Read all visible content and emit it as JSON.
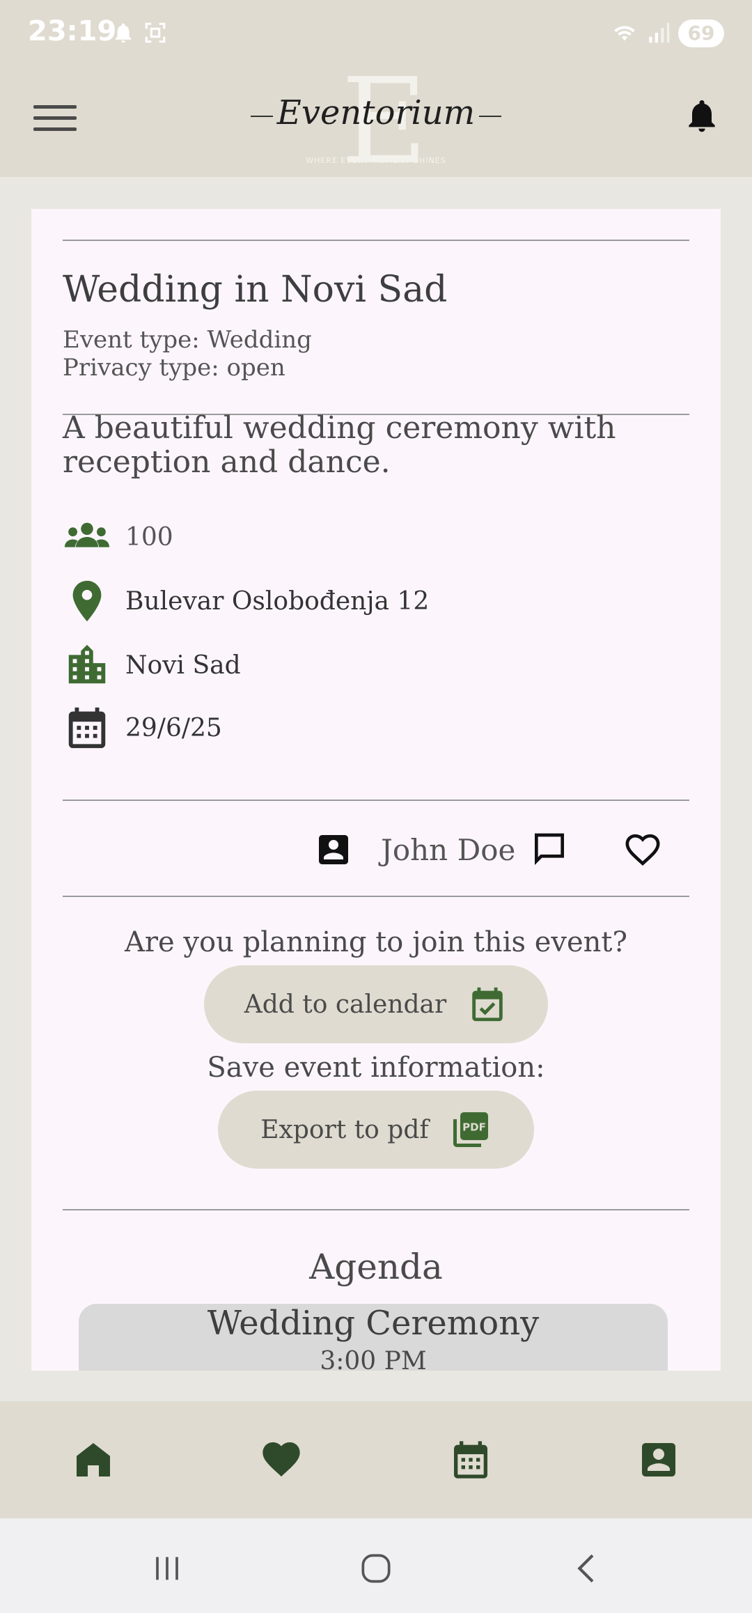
{
  "status_bar": {
    "time": "23:19",
    "battery": "69",
    "icons": [
      "bell-icon",
      "screenshot-icon",
      "wifi-icon",
      "signal-icon"
    ]
  },
  "app_bar": {
    "logo_text": "Eventorium",
    "logo_tagline": "WHERE EVERY MOMENT SHINES",
    "menu_icon": "hamburger-menu-icon",
    "notification_icon": "bell-icon"
  },
  "event": {
    "title": "Wedding in Novi Sad",
    "event_type": "Event type: Wedding",
    "privacy_type": "Privacy type: open",
    "description": "A beautiful wedding ceremony with reception and dance.",
    "guests": "100",
    "address": "Bulevar Oslobođenja 12",
    "city": "Novi Sad",
    "date": "29/6/25"
  },
  "organizer": {
    "name": "John Doe",
    "icons": [
      "contact-card-icon",
      "chat-icon",
      "heart-outline-icon"
    ]
  },
  "actions": {
    "join_question": "Are you planning to join this event?",
    "calendar_label": "Add to calendar",
    "save_question": "Save event information:",
    "pdf_label": "Export to pdf"
  },
  "agenda": {
    "title": "Agenda",
    "items": [
      {
        "name": "Wedding Ceremony",
        "time": "3:00 PM"
      }
    ]
  },
  "bottom_nav": [
    "home-icon",
    "favorites-icon",
    "calendar-icon",
    "profile-icon"
  ],
  "colors": {
    "accent_green": "#3f6b33",
    "bar_beige": "#dfdbd0",
    "card_bg": "#fcf6fc"
  }
}
